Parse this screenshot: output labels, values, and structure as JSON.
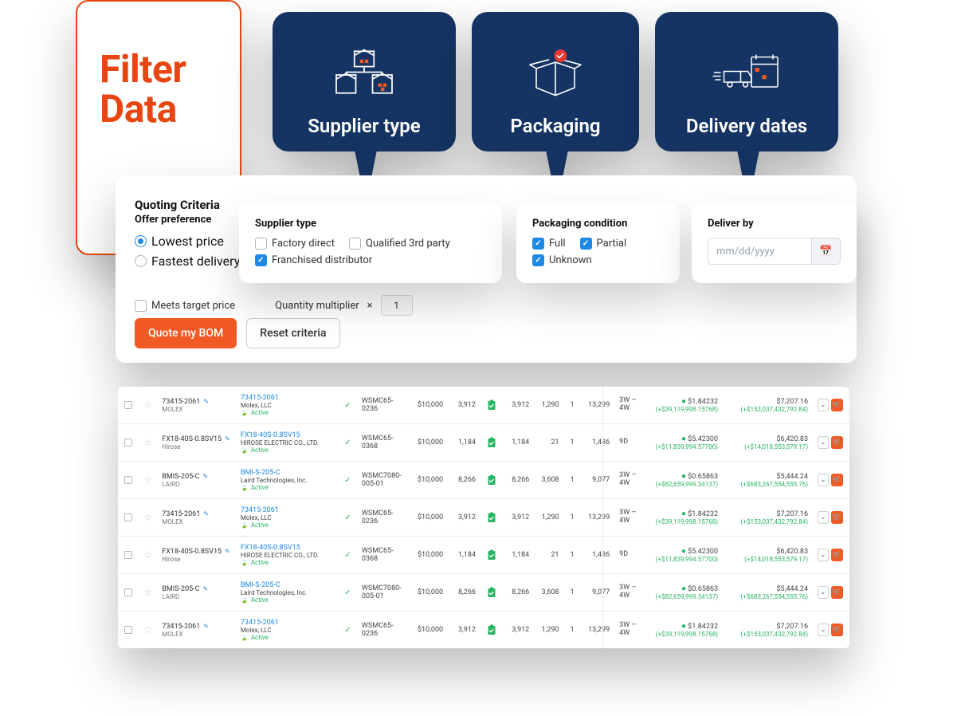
{
  "theme": {
    "accent": "#F15A24",
    "navy": "#153463",
    "link": "#1E88E5",
    "success": "#29B463"
  },
  "hero": {
    "filter_title": "Filter\nData",
    "cards": [
      {
        "label": "Supplier type"
      },
      {
        "label": "Packaging"
      },
      {
        "label": "Delivery dates"
      }
    ]
  },
  "criteria": {
    "title": "Quoting Criteria",
    "offer_label": "Offer preference",
    "offer_options": {
      "lowest": "Lowest price",
      "fastest": "Fastest delivery"
    },
    "offer_selected": "lowest",
    "supplier": {
      "title": "Supplier type",
      "factory": "Factory direct",
      "franchised": "Franchised distributor",
      "qualified": "Qualified 3rd party",
      "checked": [
        "franchised"
      ]
    },
    "packaging": {
      "title": "Packaging condition",
      "full": "Full",
      "partial": "Partial",
      "unknown": "Unknown",
      "checked": [
        "full",
        "partial",
        "unknown"
      ]
    },
    "deliver": {
      "title": "Deliver by",
      "placeholder": "mm/dd/yyyy"
    },
    "meets_target": "Meets target price",
    "qty_label": "Quantity multiplier",
    "qty_x": "×",
    "qty_value": "1",
    "quote_btn": "Quote my BOM",
    "reset_btn": "Reset criteria"
  },
  "rows": [
    {
      "part": "73415-2061",
      "brand": "MOLEX",
      "mfr_part": "73415-2061",
      "mfr": "Molex, LLC",
      "status": "Active",
      "wh": "WSMC65-0236",
      "price": "$10,000",
      "qty": "3,912",
      "n1": "3,912",
      "n2": "1,290",
      "n3": "1",
      "n4": "13,299",
      "lead": "3W – 4W",
      "unit": "$1.84232",
      "unit_sub": "(+$39,119,998.15768)",
      "ext": "$7,207.16",
      "ext_sub": "(+$153,037,432,792.84)"
    },
    {
      "part": "FX18-40S-0.8SV15",
      "brand": "Hirose",
      "mfr_part": "FX18-40S-0.8SV15",
      "mfr": "HIROSE ELECTRIC CO., LTD.",
      "status": "Active",
      "wh": "WSMC65-0368",
      "price": "$10,000",
      "qty": "1,184",
      "n1": "1,184",
      "n2": "21",
      "n3": "1",
      "n4": "1,486",
      "lead": "9D",
      "unit": "$5.42300",
      "unit_sub": "(+$11,839,994.57700)",
      "ext": "$6,420.83",
      "ext_sub": "(+$14,018,553,579.17)"
    },
    {
      "part": "BMIS-205-C",
      "brand": "LAIRD",
      "mfr_part": "BMI-S-205-C",
      "mfr": "Laird Technologies, Inc.",
      "status": "Active",
      "wh": "WSMC7080-005-01",
      "price": "$10,000",
      "qty": "8,266",
      "n1": "8,266",
      "n2": "3,608",
      "n3": "1",
      "n4": "9,077",
      "lead": "3W – 4W",
      "unit": "$0.65863",
      "unit_sub": "(+$82,659,999.34137)",
      "ext": "$5,444.24",
      "ext_sub": "(+$683,267,554,555.76)"
    },
    {
      "part": "73415-2061",
      "brand": "MOLEX",
      "mfr_part": "73415-2061",
      "mfr": "Molex, LLC",
      "status": "Active",
      "wh": "WSMC65-0236",
      "price": "$10,000",
      "qty": "3,912",
      "n1": "3,912",
      "n2": "1,290",
      "n3": "1",
      "n4": "13,299",
      "lead": "3W – 4W",
      "unit": "$1.84232",
      "unit_sub": "(+$39,119,998.15768)",
      "ext": "$7,207.16",
      "ext_sub": "(+$153,037,432,792.84)"
    },
    {
      "part": "FX18-40S-0.8SV15",
      "brand": "Hirose",
      "mfr_part": "FX18-40S-0.8SV15",
      "mfr": "HIROSE ELECTRIC CO., LTD.",
      "status": "Active",
      "wh": "WSMC65-0368",
      "price": "$10,000",
      "qty": "1,184",
      "n1": "1,184",
      "n2": "21",
      "n3": "1",
      "n4": "1,486",
      "lead": "9D",
      "unit": "$5.42300",
      "unit_sub": "(+$11,839,994.57700)",
      "ext": "$6,420.83",
      "ext_sub": "(+$14,018,553,579.17)"
    },
    {
      "part": "BMIS-205-C",
      "brand": "LAIRD",
      "mfr_part": "BMI-S-205-C",
      "mfr": "Laird Technologies, Inc.",
      "status": "Active",
      "wh": "WSMC7080-005-01",
      "price": "$10,000",
      "qty": "8,266",
      "n1": "8,266",
      "n2": "3,608",
      "n3": "1",
      "n4": "9,077",
      "lead": "3W – 4W",
      "unit": "$0.65863",
      "unit_sub": "(+$82,659,999.34137)",
      "ext": "$5,444.24",
      "ext_sub": "(+$683,267,554,555.76)"
    },
    {
      "part": "73415-2061",
      "brand": "MOLEX",
      "mfr_part": "73415-2061",
      "mfr": "Molex, LLC",
      "status": "Active",
      "wh": "WSMC65-0236",
      "price": "$10,000",
      "qty": "3,912",
      "n1": "3,912",
      "n2": "1,290",
      "n3": "1",
      "n4": "13,299",
      "lead": "3W – 4W",
      "unit": "$1.84232",
      "unit_sub": "(+$39,119,998.15768)",
      "ext": "$7,207.16",
      "ext_sub": "(+$153,037,432,792.84)"
    }
  ]
}
